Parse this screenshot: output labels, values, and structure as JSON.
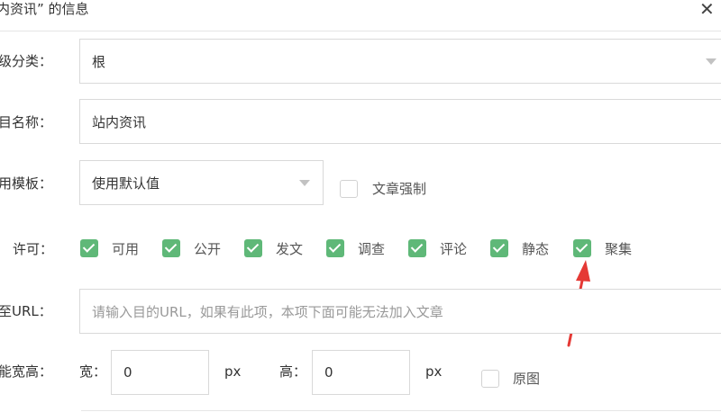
{
  "dialog": {
    "title": "内资讯” 的信息",
    "close_icon": "close-icon"
  },
  "form": {
    "parent": {
      "label": "级分类：",
      "value": "根"
    },
    "name": {
      "label": "目名称：",
      "value": "站内资讯"
    },
    "template": {
      "label": "用模板：",
      "value": "使用默认值",
      "force_label": "文章强制",
      "force_checked": false
    },
    "permissions": {
      "label": "许可：",
      "items": [
        {
          "label": "可用",
          "checked": true
        },
        {
          "label": "公开",
          "checked": true
        },
        {
          "label": "发文",
          "checked": true
        },
        {
          "label": "调查",
          "checked": true
        },
        {
          "label": "评论",
          "checked": true
        },
        {
          "label": "静态",
          "checked": true
        },
        {
          "label": "聚集",
          "checked": true
        }
      ]
    },
    "url": {
      "label": "至URL：",
      "placeholder": "请输入目的URL，如果有此项，本项下面可能无法加入文章"
    },
    "size": {
      "label": "能宽高：",
      "width_label": "宽：",
      "width_value": "0",
      "width_unit": "px",
      "height_label": "高：",
      "height_value": "0",
      "height_unit": "px",
      "original_label": "原图",
      "original_checked": false
    }
  },
  "colors": {
    "checked": "#5fb878",
    "annotation_arrow": "#e53935"
  }
}
